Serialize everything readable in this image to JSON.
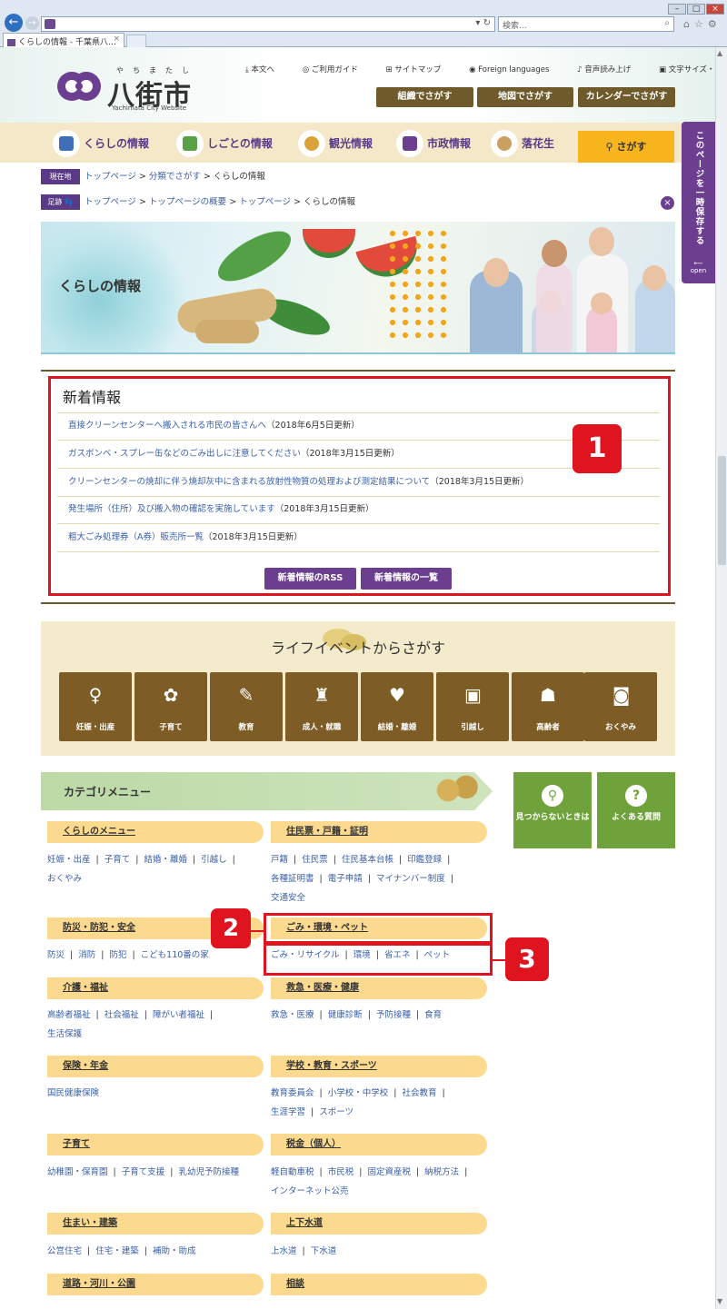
{
  "browser": {
    "address": "",
    "address_tools": "▾ ↻",
    "search_placeholder": "検索...",
    "tab_title": "くらしの情報 - 千葉県八…",
    "tab_close": "×"
  },
  "header": {
    "logo_ruby": "やちまたし",
    "logo_text": "八街市",
    "logo_sub": "Yachimata City Website",
    "top_links": [
      "本文へ",
      "ご利用ガイド",
      "サイトマップ",
      "Foreign languages",
      "音声読み上げ",
      "文字サイズ・色合い変更"
    ],
    "buttons": [
      "組織でさがす",
      "地図でさがす",
      "カレンダーでさがす"
    ]
  },
  "nav": {
    "items": [
      "くらしの情報",
      "しごとの情報",
      "観光情報",
      "市政情報",
      "落花生"
    ],
    "search": "さがす",
    "side_tab": "このページを一時保存する",
    "side_open": "open"
  },
  "breadcrumbs": {
    "current_tag": "現在地",
    "current": [
      "トップページ",
      "分類でさがす",
      "くらしの情報"
    ],
    "footprint_tag": "足跡",
    "footprint": [
      "トップページ",
      "トップページの概要",
      "トップページ",
      "くらしの情報"
    ],
    "sep": ">"
  },
  "banner": {
    "title": "くらしの情報"
  },
  "news": {
    "title": "新着情報",
    "items": [
      {
        "link": "直接クリーンセンターへ搬入される市民の皆さんへ",
        "date": "（2018年6月5日更新）"
      },
      {
        "link": "ガスボンベ・スプレー缶などのごみ出しに注意してください",
        "date": "（2018年3月15日更新）"
      },
      {
        "link": "クリーンセンターの焼却に伴う焼却灰中に含まれる放射性物質の処理および測定結果について",
        "date": "（2018年3月15日更新）"
      },
      {
        "link": "発生場所（住所）及び搬入物の確認を実施しています",
        "date": "（2018年3月15日更新）"
      },
      {
        "link": "粗大ごみ処理券（A券）販売所一覧",
        "date": "（2018年3月15日更新）"
      }
    ],
    "rss_button": "新着情報のRSS",
    "list_button": "新着情報の一覧"
  },
  "annotations": {
    "badge1": "1",
    "badge2": "2",
    "badge3": "3",
    "color": "#e0141e"
  },
  "life_events": {
    "title": "ライフイベントからさがす",
    "items": [
      "妊娠・出産",
      "子育て",
      "教育",
      "成人・就職",
      "結婚・離婚",
      "引越し",
      "高齢者",
      "おくやみ"
    ]
  },
  "categories": {
    "title": "カテゴリメニュー",
    "help_buttons": [
      "見つからないときは",
      "よくある質問"
    ],
    "groups": [
      {
        "head": "くらしのメニュー",
        "links": [
          "妊娠・出産",
          "子育て",
          "結婚・離婚",
          "引越し",
          "おくやみ"
        ]
      },
      {
        "head": "住民票・戸籍・証明",
        "links": [
          "戸籍",
          "住民票",
          "住民基本台帳",
          "印鑑登録",
          "各種証明書",
          "電子申請",
          "マイナンバー制度",
          "交通安全"
        ]
      },
      {
        "head": "防災・防犯・安全",
        "links": [
          "防災",
          "消防",
          "防犯",
          "こども110番の家"
        ]
      },
      {
        "head": "ごみ・環境・ペット",
        "links": [
          "ごみ・リサイクル",
          "環境",
          "省エネ",
          "ペット"
        ]
      },
      {
        "head": "介護・福祉",
        "links": [
          "高齢者福祉",
          "社会福祉",
          "障がい者福祉",
          "生活保護"
        ]
      },
      {
        "head": "救急・医療・健康",
        "links": [
          "救急・医療",
          "健康診断",
          "予防接種",
          "食育"
        ]
      },
      {
        "head": "保険・年金",
        "links": [
          "国民健康保険"
        ]
      },
      {
        "head": "学校・教育・スポーツ",
        "links": [
          "教育委員会",
          "小学校・中学校",
          "社会教育",
          "生涯学習",
          "スポーツ"
        ]
      },
      {
        "head": "子育て",
        "links": [
          "幼稚園・保育園",
          "子育て支援",
          "乳幼児予防接種"
        ]
      },
      {
        "head": "税金（個人）",
        "links": [
          "軽自動車税",
          "市民税",
          "固定資産税",
          "納税方法",
          "インターネット公売"
        ]
      },
      {
        "head": "住まい・建築",
        "links": [
          "公営住宅",
          "住宅・建築",
          "補助・助成"
        ]
      },
      {
        "head": "上下水道",
        "links": [
          "上水道",
          "下水道"
        ]
      },
      {
        "head": "道路・河川・公園",
        "links": []
      },
      {
        "head": "相談",
        "links": []
      }
    ]
  },
  "colors": {
    "purple": "#6b3e8f",
    "brown": "#7d5d25",
    "green": "#6fa23a",
    "orange": "#f7b41d"
  }
}
